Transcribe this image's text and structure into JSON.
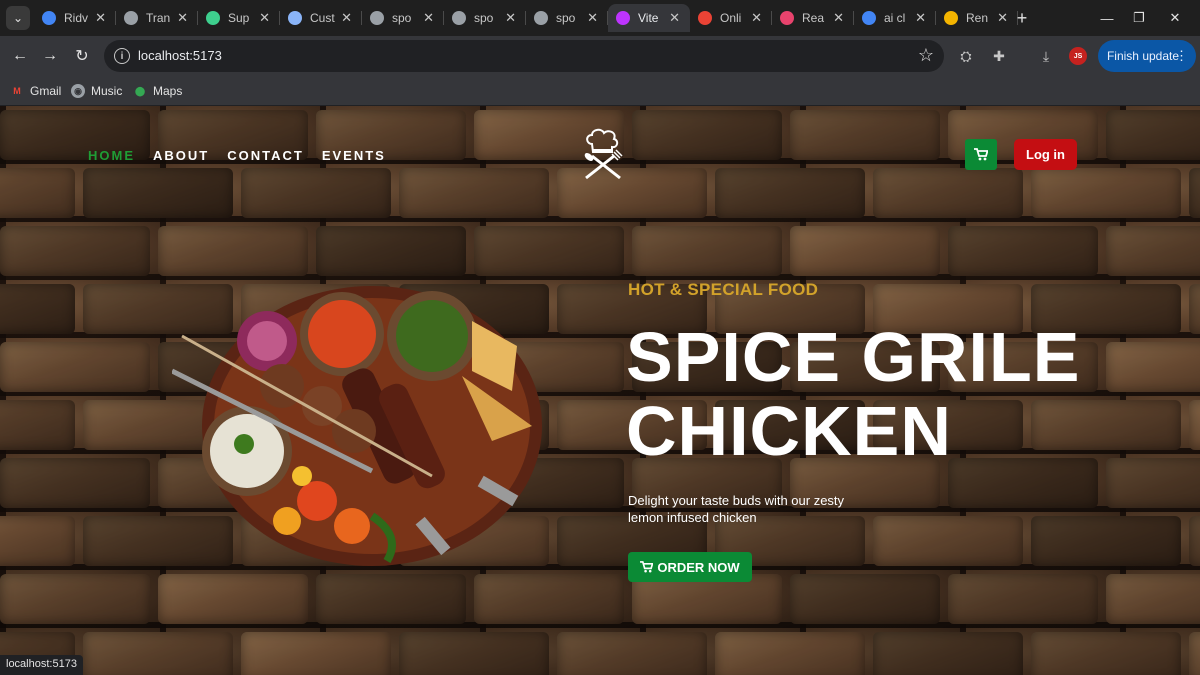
{
  "browser": {
    "tabs": [
      {
        "title": "Ridv",
        "icon": "chrome-icon",
        "color": "#4285f4"
      },
      {
        "title": "Tran",
        "icon": "loading-icon",
        "color": "#9aa0a6"
      },
      {
        "title": "Sup",
        "icon": "supabase-icon",
        "color": "#3ecf8e"
      },
      {
        "title": "Cust",
        "icon": "globe-icon",
        "color": "#8ab4f8"
      },
      {
        "title": "spo",
        "icon": "openai-icon",
        "color": "#9aa0a6"
      },
      {
        "title": "spo",
        "icon": "openai-icon",
        "color": "#9aa0a6"
      },
      {
        "title": "spo",
        "icon": "openai-icon",
        "color": "#9aa0a6"
      },
      {
        "title": "Vite",
        "icon": "vite-icon",
        "color": "#bd34fe",
        "active": true
      },
      {
        "title": "Onli",
        "icon": "bookmark-icon",
        "color": "#ea4335"
      },
      {
        "title": "Rea",
        "icon": "react-icon",
        "color": "#e8436d"
      },
      {
        "title": "ai cl",
        "icon": "google-icon",
        "color": "#4285f4"
      },
      {
        "title": "Ren",
        "icon": "site-icon",
        "color": "#f4b400"
      }
    ],
    "address": "localhost:5173",
    "profile_initials": "JS",
    "finish_update": "Finish update",
    "bookmarks": [
      {
        "label": "Gmail",
        "icon": "gmail-icon"
      },
      {
        "label": "Music",
        "icon": "music-icon"
      },
      {
        "label": "Maps",
        "icon": "maps-icon"
      }
    ],
    "status_url": "localhost:5173"
  },
  "site": {
    "nav": [
      "HOME",
      "ABOUT",
      "CONTACT",
      "EVENTS"
    ],
    "login": "Log in",
    "kicker": "HOT & SPECIAL FOOD",
    "headline_line1": "SPICE GRILE",
    "headline_line2": "CHICKEN",
    "description": "Delight your taste buds with our zesty lemon infused chicken",
    "order_button": "ORDER NOW"
  },
  "colors": {
    "nav_active": "#1f9d35",
    "kicker": "#d2a22a",
    "order_button": "#0b8a35",
    "login_button": "#c40e12"
  }
}
